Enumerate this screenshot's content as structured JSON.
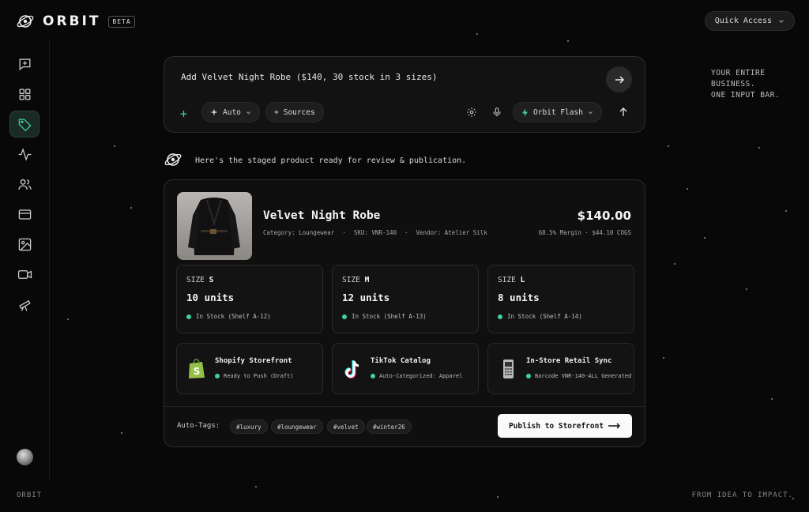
{
  "app": {
    "name": "ORBIT",
    "badge": "BETA"
  },
  "header": {
    "quick_access": "Quick Access"
  },
  "sidebar": {
    "items": [
      {
        "icon": "chat-plus-icon"
      },
      {
        "icon": "grid-icon"
      },
      {
        "icon": "tag-icon",
        "active": true
      },
      {
        "icon": "activity-icon"
      },
      {
        "icon": "users-icon"
      },
      {
        "icon": "credit-card-icon"
      },
      {
        "icon": "image-icon"
      },
      {
        "icon": "video-icon"
      },
      {
        "icon": "telescope-icon"
      }
    ]
  },
  "tagline": [
    "YOUR ENTIRE",
    "BUSINESS.",
    "ONE INPUT BAR."
  ],
  "input": {
    "prompt": "Add Velvet Night Robe ($140, 30 stock in 3 sizes)",
    "mode": "Auto",
    "sources": "Sources",
    "model": "Orbit Flash"
  },
  "assistant": {
    "message": "Here's the staged product ready for review & publication."
  },
  "product": {
    "name": "Velvet Night Robe",
    "price": "$140.00",
    "category": "Category: Loungewear",
    "sku": "SKU: VNR-140",
    "vendor": "Vendor: Atelier Silk",
    "margin": "68.5% Margin · $44.10 COGS",
    "sizes": [
      {
        "label": "SIZE",
        "size": "S",
        "units": "10 units",
        "stock": "In Stock (Shelf A-12)"
      },
      {
        "label": "SIZE",
        "size": "M",
        "units": "12 units",
        "stock": "In Stock (Shelf A-13)"
      },
      {
        "label": "SIZE",
        "size": "L",
        "units": "8 units",
        "stock": "In Stock (Shelf A-14)"
      }
    ],
    "channels": [
      {
        "title": "Shopify Storefront",
        "status": "Ready to Push (Draft)",
        "icon": "shopify-icon"
      },
      {
        "title": "TikTok Catalog",
        "status": "Auto-Categorized: Apparel",
        "icon": "tiktok-icon"
      },
      {
        "title": "In-Store Retail Sync",
        "status": "Barcode VNR-140-ALL Generated",
        "icon": "pos-terminal-icon"
      }
    ],
    "tags_label": "Auto-Tags:",
    "tags": [
      "#luxury",
      "#loungewear",
      "#velvet",
      "#winter26"
    ],
    "publish": "Publish to Storefront"
  },
  "footer": {
    "left": "ORBIT",
    "right": "FROM IDEA TO IMPACT."
  },
  "colors": {
    "accent": "#3fd1a5",
    "background": "#080808",
    "card": "#0f0f0f"
  }
}
